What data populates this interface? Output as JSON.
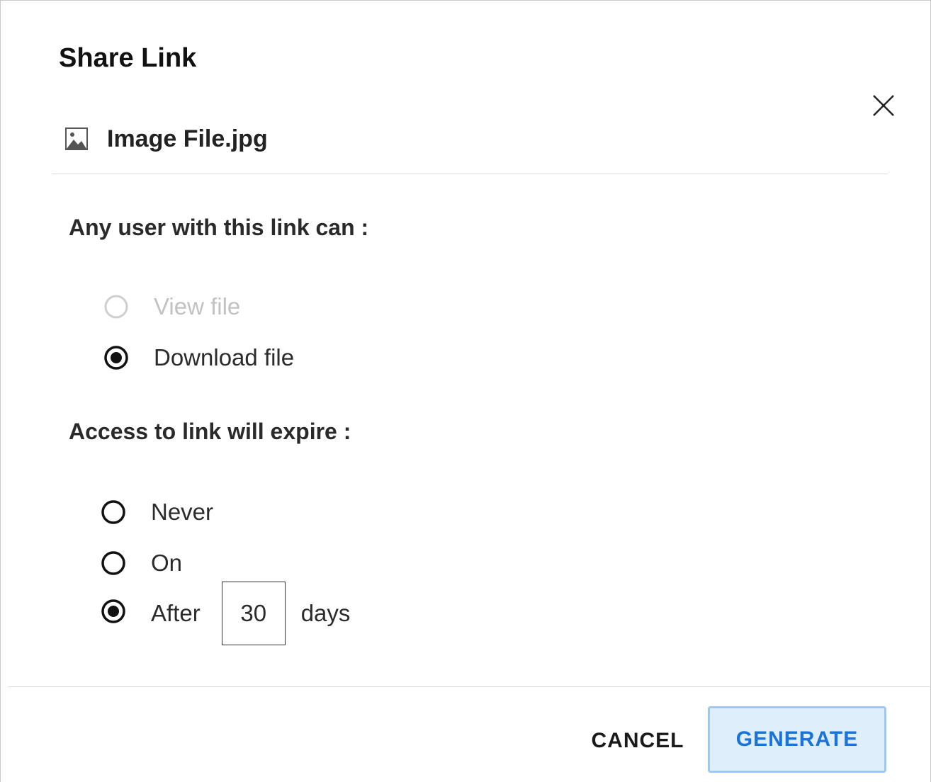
{
  "dialog": {
    "title": "Share Link",
    "file_name": "Image File.jpg"
  },
  "permissions": {
    "label": "Any user with this link can :",
    "options": [
      {
        "label": "View file",
        "selected": false,
        "disabled": true
      },
      {
        "label": "Download file",
        "selected": true,
        "disabled": false
      }
    ]
  },
  "expiry": {
    "label": "Access to link will expire :",
    "options": [
      {
        "label": "Never",
        "selected": false
      },
      {
        "label": "On",
        "selected": false
      },
      {
        "label": "After",
        "selected": true
      }
    ],
    "days_value": "30",
    "days_unit": "days"
  },
  "footer": {
    "cancel_label": "CANCEL",
    "generate_label": "GENERATE"
  },
  "colors": {
    "accent": "#1a73d9",
    "generate_bg": "#dfeefb",
    "generate_border": "#9ec8ef",
    "disabled_text": "#c2c2c2"
  },
  "icons": {
    "file": "image-file-icon",
    "close": "close-icon"
  }
}
